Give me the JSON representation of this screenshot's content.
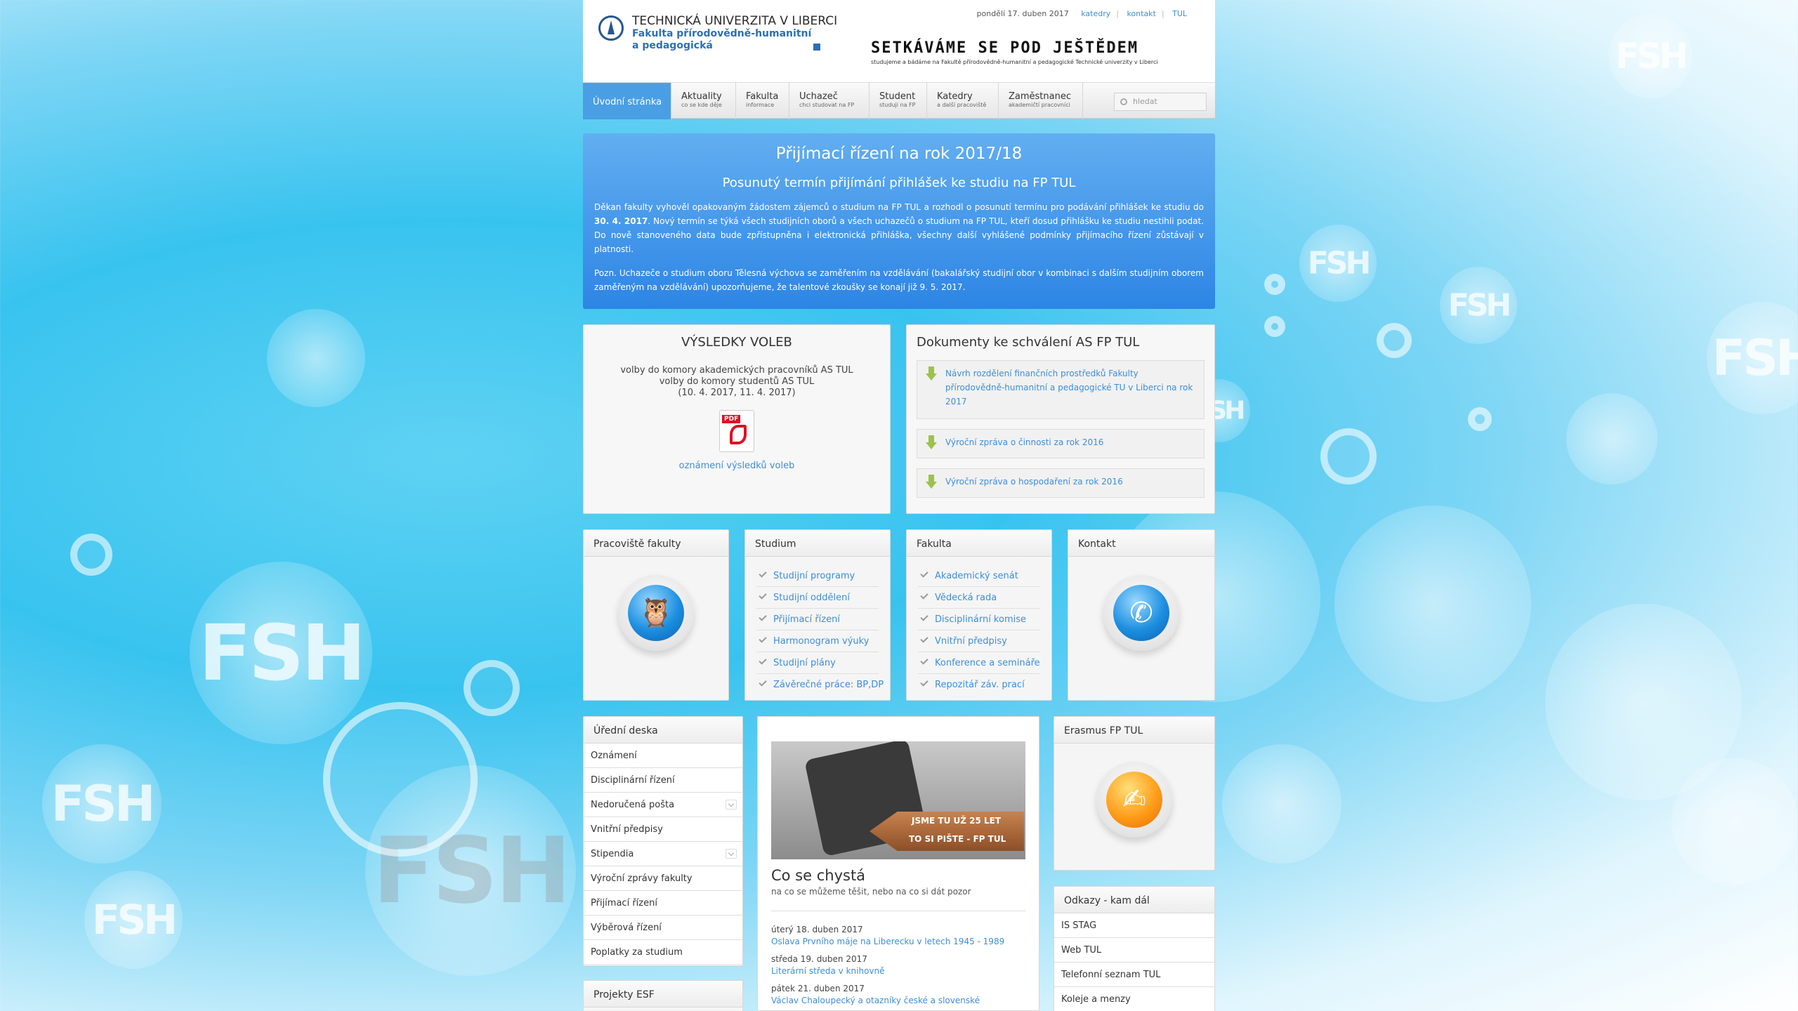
{
  "header": {
    "university": "TECHNICKÁ UNIVERZITA V LIBERCI",
    "faculty_line1": "Fakulta přírodovědně-humanitní",
    "faculty_line2": "a pedagogická",
    "date": "pondělí 17. duben 2017",
    "links": [
      "katedry",
      "kontakt",
      "TUL"
    ],
    "slogan": "SETKÁVÁME SE POD JEŠTĚDEM",
    "slogan_sub": "studujeme a bádáme na Fakultě přírodovědně-humanitní a pedagogické Technické univerzity v Liberci"
  },
  "nav": {
    "items": [
      {
        "label": "Úvodní stránka",
        "sub": ""
      },
      {
        "label": "Aktuality",
        "sub": "co se kde děje"
      },
      {
        "label": "Fakulta",
        "sub": "informace"
      },
      {
        "label": "Uchazeč",
        "sub": "chci studovat na FP"
      },
      {
        "label": "Student",
        "sub": "studuji na FP"
      },
      {
        "label": "Katedry",
        "sub": "a další pracoviště"
      },
      {
        "label": "Zaměstnanec",
        "sub": "akademičtí pracovníci"
      }
    ],
    "search_placeholder": "hledat"
  },
  "banner": {
    "title": "Přijímací řízení na rok 2017/18",
    "subtitle": "Posunutý termín přijímání přihlášek ke studiu na FP TUL",
    "p1_a": "Děkan fakulty vyhověl opakovaným žádostem zájemců o studium na FP TUL a rozhodl o posunutí termínu pro podávání přihlášek ke studiu do ",
    "p1_date": "30. 4. 2017",
    "p1_b": ". Nový termín se týká všech studijních oborů a všech uchazečů o studium na FP TUL, kteří dosud přihlášku ke studiu nestihli podat. Do nově stanoveného data bude zpřístupněna i elektronická přihláška, všechny další vyhlášené podmínky přijímacího řízení zůstávají v platnosti.",
    "p2": "Pozn. Uchazeče o studium oboru Tělesná výchova se zaměřením na vzdělávání (bakalářský studijní obor v kombinaci s dalším studijním oborem zaměřeným na vzdělávání) upozorňujeme, že talentové zkoušky se konají již 9. 5. 2017."
  },
  "voting": {
    "title": "VÝSLEDKY VOLEB",
    "line1": "volby do komory akademických pracovníků AS TUL",
    "line2": "volby do komory studentů AS TUL",
    "line3": "(10. 4. 2017, 11. 4. 2017)",
    "pdf_label": "PDF",
    "link": "oznámení výsledků voleb"
  },
  "docs": {
    "title": "Dokumenty ke schválení AS FP TUL",
    "items": [
      "Návrh rozdělení finančních prostředků Fakulty přírodovědně-humanitní a pedagogické TU v Liberci na rok 2017",
      "Výroční zpráva o činnosti za rok 2016",
      "Výroční zpráva o hospodaření za rok 2016"
    ]
  },
  "workplaces": {
    "title": "Pracoviště fakulty",
    "icon": "owl-icon"
  },
  "study": {
    "title": "Studium",
    "items": [
      "Studijní programy",
      "Studijní oddělení",
      "Přijímací řízení",
      "Harmonogram výuky",
      "Studijní plány",
      "Závěrečné práce: BP,DP"
    ]
  },
  "faculty": {
    "title": "Fakulta",
    "items": [
      "Akademický senát",
      "Vědecká rada",
      "Disciplinární komise",
      "Vnitřní předpisy",
      "Konference a semináře",
      "Repozitář záv. prací"
    ]
  },
  "contact": {
    "title": "Kontakt",
    "icon": "phone-icon"
  },
  "board": {
    "title": "Úřední deska",
    "items": [
      {
        "label": "Oznámení",
        "expand": false
      },
      {
        "label": "Disciplinární řízení",
        "expand": false
      },
      {
        "label": "Nedoručená pošta",
        "expand": true
      },
      {
        "label": "Vnitřní předpisy",
        "expand": false
      },
      {
        "label": "Stipendia",
        "expand": true
      },
      {
        "label": "Výroční zprávy fakulty",
        "expand": false
      },
      {
        "label": "Přijímací řízení",
        "expand": false
      },
      {
        "label": "Výběrová řízení",
        "expand": false
      },
      {
        "label": "Poplatky za studium",
        "expand": false
      }
    ]
  },
  "esf": {
    "title": "Projekty ESF"
  },
  "news": {
    "photo_text1": "JSME TU UŽ 25 LET",
    "photo_text2": "TO SI PIŠTE - FP TUL",
    "title": "Co se chystá",
    "subtitle": "na co se můžeme těšit, nebo na co si dát pozor",
    "events": [
      {
        "date": "úterý 18. duben 2017",
        "title": "Oslava Prvního máje na Liberecku v letech 1945 - 1989"
      },
      {
        "date": "středa 19. duben 2017",
        "title": "Literární středa v knihovně"
      },
      {
        "date": "pátek 21. duben 2017",
        "title": "Václav Chaloupecký a otazníky české a slovenské"
      }
    ]
  },
  "erasmus": {
    "title": "Erasmus FP TUL",
    "icon": "erasmus-icon"
  },
  "links": {
    "title": "Odkazy - kam dál",
    "items": [
      "IS STAG",
      "Web TUL",
      "Telefonní seznam TUL",
      "Koleje a menzy"
    ]
  },
  "colors": {
    "accent": "#4a9fe4",
    "link": "#3d8edb",
    "banner": "#3d95ea"
  }
}
